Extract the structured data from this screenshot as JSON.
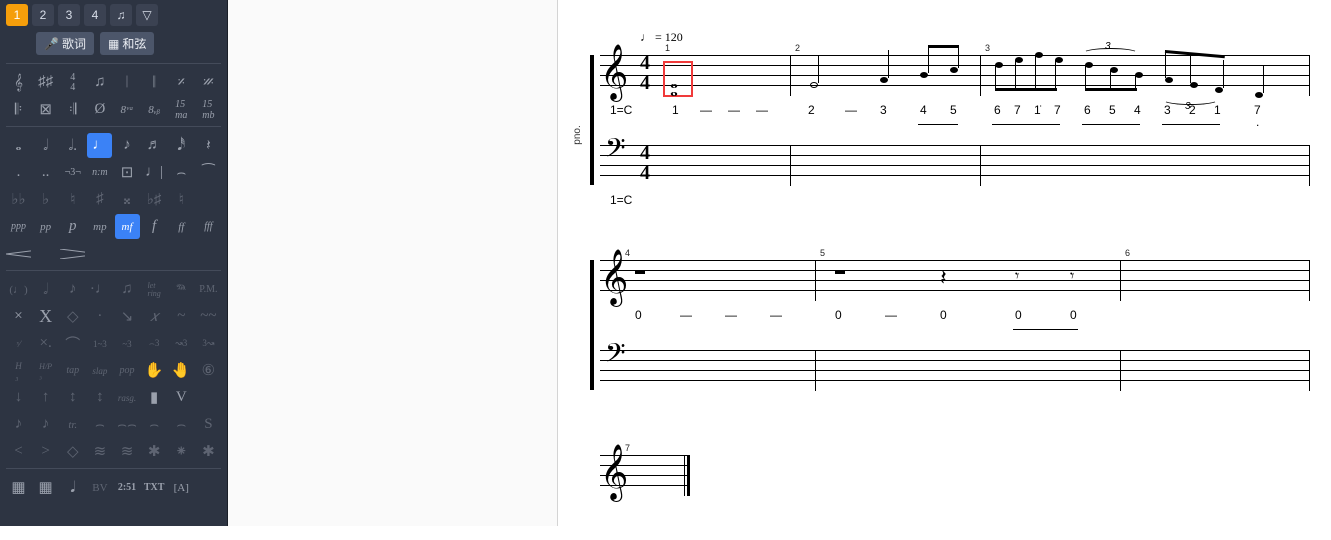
{
  "voices": {
    "v1": "1",
    "v2": "2",
    "v3": "3",
    "v4": "4"
  },
  "buttons": {
    "lyrics": "歌词",
    "chord": "和弦"
  },
  "palette": {
    "notation": [
      "𝄞",
      "♯♯♯",
      "4/4",
      "♫",
      "𝄀",
      "𝄁",
      "𝄎",
      "𝄏",
      "𝄆",
      "⊠",
      "𝄇",
      "Ø",
      "8ᵛᵃ",
      "8ᵥᵦ",
      "15ₘₐ",
      "15ₘᵦ"
    ],
    "durations": [
      "𝅝",
      "𝅗𝅥",
      "𝅗𝅥.",
      "♩",
      "♪",
      "♬",
      "𝅘𝅥𝅰",
      "𝄽",
      ".",
      "..",
      "¬3¬",
      "n:m",
      "⊡",
      "♩|",
      "⌢",
      "⁀"
    ],
    "accidentals": [
      "♭♭",
      "♭",
      "♮",
      "♯",
      "𝄪",
      "♭♯",
      "♮",
      "𝄫"
    ],
    "dynamics": [
      "ppp",
      "pp",
      "p",
      "mp",
      "mf",
      "f",
      "ff",
      "fff"
    ],
    "hairpins": [
      "<",
      ">"
    ],
    "articulations_a": [
      "(♩)",
      "𝅗𝅥",
      "♪",
      "·♩",
      "♫",
      "let\nring",
      "𝄐",
      "P.M."
    ],
    "articulations_b": [
      "×",
      "X",
      "◇",
      "·",
      "↘",
      "𝑥",
      "~",
      "~~",
      "ˣ⁄",
      "×.",
      "⌒",
      "1~3",
      "~3",
      "⌢3",
      "↝3",
      "3↝",
      "H₋₃",
      "H/P₋₃",
      "tap",
      "slap",
      "pop",
      "✋",
      "🤚",
      "⑥",
      "↓",
      "↑",
      "↕",
      "↕",
      "rasg.",
      "▮",
      "V",
      "",
      "♪",
      "♪",
      "tr.",
      "⌢",
      "⌢⌢",
      "⌢",
      "⌢",
      "S",
      "<",
      ">",
      "◇",
      "≋",
      "≋",
      "✱",
      "⁕",
      "✱"
    ],
    "footer": [
      "▦",
      "▦",
      "𝅘𝅥",
      "BV",
      "2:51",
      "TXT",
      "[A]"
    ]
  },
  "score": {
    "instrument_label": "pno.",
    "tempo": "♩ = 120",
    "time_sig": {
      "num": "4",
      "den": "4"
    },
    "key_text": "1=C",
    "systems": [
      {
        "bars": [
          1,
          2,
          3
        ],
        "jianpu_top": [
          "1",
          "—",
          "—",
          "—",
          "2",
          "—",
          "3",
          "4",
          "5",
          "6",
          "7",
          "1̇",
          "7",
          "6",
          "5",
          "4",
          "3",
          "2",
          "1",
          "7"
        ],
        "jianpu_bottom": []
      },
      {
        "bars": [
          4,
          5,
          6
        ],
        "jianpu_top": [
          "0",
          "—",
          "—",
          "—",
          "0",
          "—",
          "0",
          "0",
          "0"
        ],
        "jianpu_bottom": []
      },
      {
        "bars": [
          7
        ]
      }
    ]
  },
  "chart_data": {
    "type": "music-notation",
    "tempo_bpm": 120,
    "time_signature": "4/4",
    "key": "C",
    "measures": 7,
    "highlighted_object": {
      "measure": 1,
      "beat": 1,
      "type": "whole-note-chord"
    }
  }
}
